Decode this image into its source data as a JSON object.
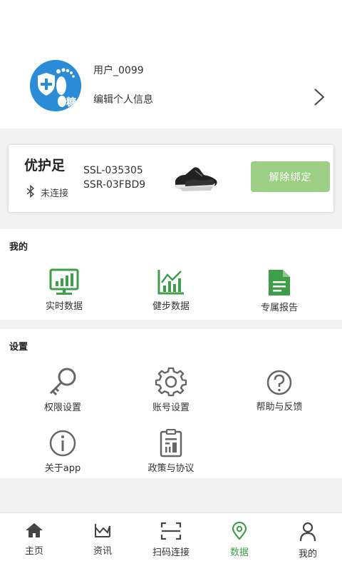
{
  "profile": {
    "avatar_text": "糖",
    "username": "用户_0099",
    "edit_label": "编辑个人信息"
  },
  "device": {
    "name": "优护足",
    "bluetooth_status": "未连接",
    "id_left": "SSL-035305",
    "id_right": "SSR-03FBD9",
    "unbind_label": "解除绑定",
    "unbind_color": "#9ccf84"
  },
  "mine": {
    "title": "我的",
    "items": [
      {
        "label": "实时数据",
        "icon": "monitor-chart-icon"
      },
      {
        "label": "健步数据",
        "icon": "bar-chart-icon"
      },
      {
        "label": "专属报告",
        "icon": "document-icon"
      }
    ]
  },
  "settings": {
    "title": "设置",
    "items": [
      {
        "label": "权限设置",
        "icon": "key-icon"
      },
      {
        "label": "账号设置",
        "icon": "gear-icon"
      },
      {
        "label": "帮助与反馈",
        "icon": "help-icon"
      },
      {
        "label": "关于app",
        "icon": "info-icon"
      },
      {
        "label": "政策与协议",
        "icon": "clipboard-icon"
      }
    ]
  },
  "tabbar": {
    "items": [
      {
        "label": "主页",
        "icon": "home-icon"
      },
      {
        "label": "资讯",
        "icon": "news-icon"
      },
      {
        "label": "扫码连接",
        "icon": "scan-icon"
      },
      {
        "label": "数据",
        "icon": "location-icon"
      },
      {
        "label": "我的",
        "icon": "user-icon"
      }
    ],
    "active_index": 3
  },
  "colors": {
    "accent": "#3f9e4a",
    "icon_gray": "#666666",
    "avatar_blue": "#2a8bd6"
  }
}
